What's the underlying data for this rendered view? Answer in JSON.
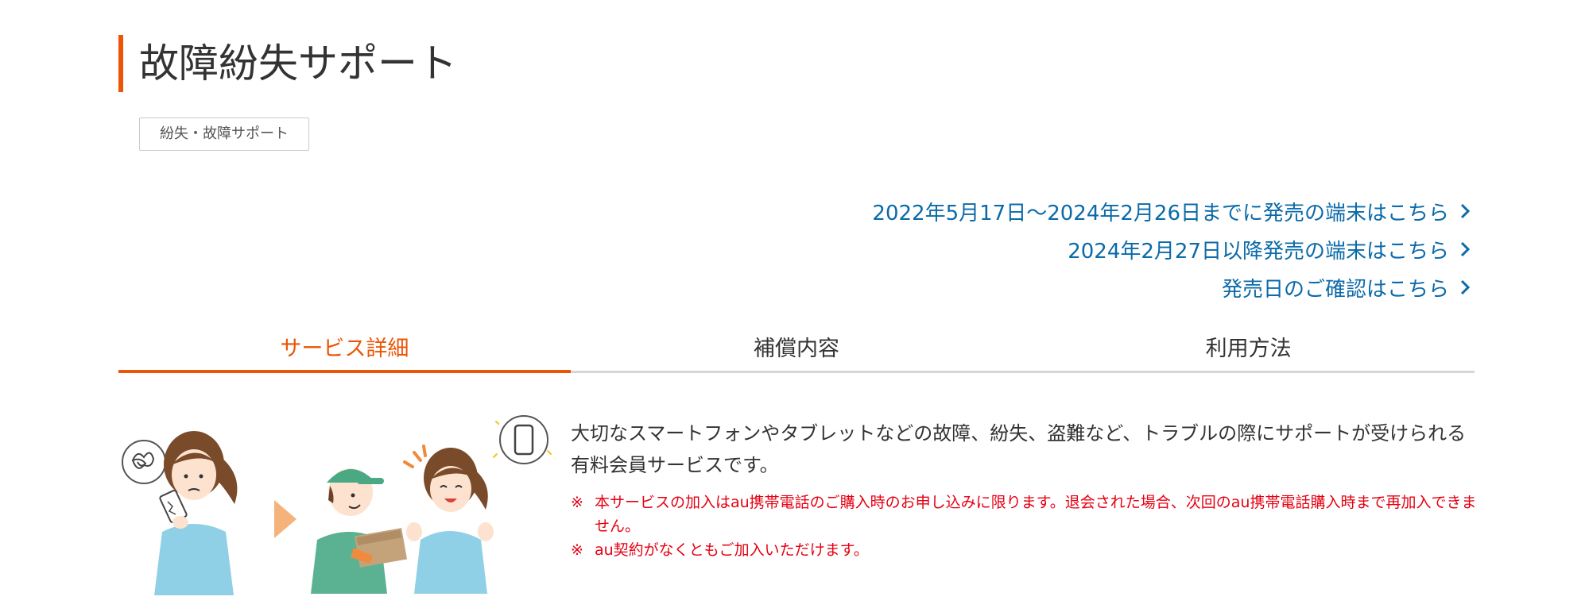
{
  "page": {
    "title": "故障紛失サポート",
    "tag": "紛失・故障サポート",
    "accent_color": "#eb5505",
    "link_color": "#0b6aa9",
    "notice_color": "#e60012"
  },
  "links": [
    {
      "label": "2022年5月17日〜2024年2月26日までに発売の端末はこちら",
      "icon": "chevron-right-icon"
    },
    {
      "label": "2024年2月27日以降発売の端末はこちら",
      "icon": "chevron-right-icon"
    },
    {
      "label": "発売日のご確認はこちら",
      "icon": "chevron-right-icon"
    }
  ],
  "tabs": [
    {
      "label": "サービス詳細",
      "active": true
    },
    {
      "label": "補償内容",
      "active": false
    },
    {
      "label": "利用方法",
      "active": false
    }
  ],
  "content": {
    "description": "大切なスマートフォンやタブレットなどの故障、紛失、盗難など、トラブルの際にサポートが受けられる有料会員サービスです。",
    "notes": [
      {
        "mark": "※",
        "text": "本サービスの加入はau携帯電話のご購入時のお申し込みに限ります。退会された場合、次回のau携帯電話購入時まで再加入できません。"
      },
      {
        "mark": "※",
        "text": "au契約がなくともご加入いただけます。"
      }
    ]
  }
}
